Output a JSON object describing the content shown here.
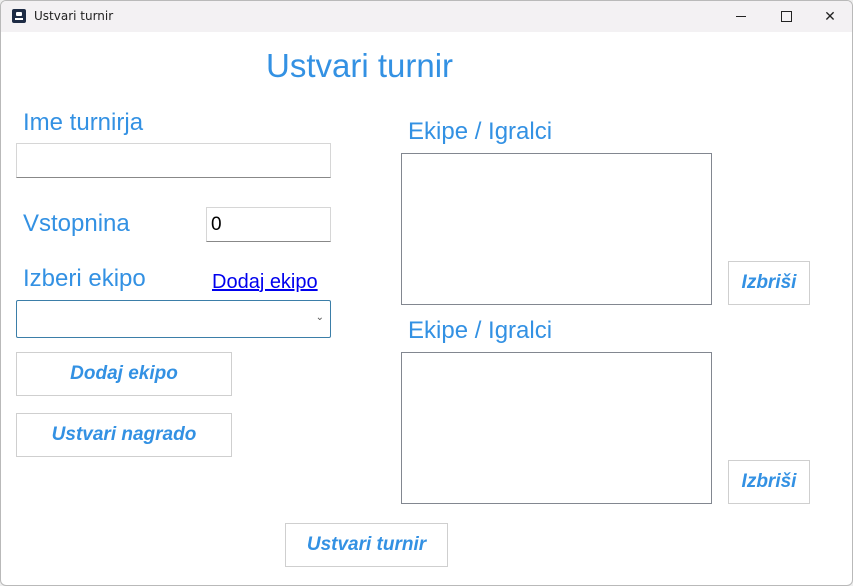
{
  "window": {
    "title": "Ustvari turnir",
    "controls": {
      "minimize": "minimize-icon",
      "maximize": "maximize-icon",
      "close": "close-icon"
    }
  },
  "form": {
    "heading": "Ustvari turnir",
    "name_label": "Ime turnirja",
    "name_value": "",
    "fee_label": "Vstopnina",
    "fee_value": "0",
    "team_select_label": "Izberi ekipo",
    "add_team_link": "Dodaj ekipo",
    "team_select_value": "",
    "add_team_button": "Dodaj ekipo",
    "create_prize_button": "Ustvari nagrado",
    "create_tournament_button": "Ustvari turnir"
  },
  "lists": [
    {
      "label": "Ekipe / Igralci",
      "items": [],
      "delete_button": "Izbriši"
    },
    {
      "label": "Ekipe / Igralci",
      "items": [],
      "delete_button": "Izbriši"
    }
  ],
  "colors": {
    "accent": "#3391e3",
    "link": "#0000ee",
    "titlebar": "#f3f1f3"
  }
}
